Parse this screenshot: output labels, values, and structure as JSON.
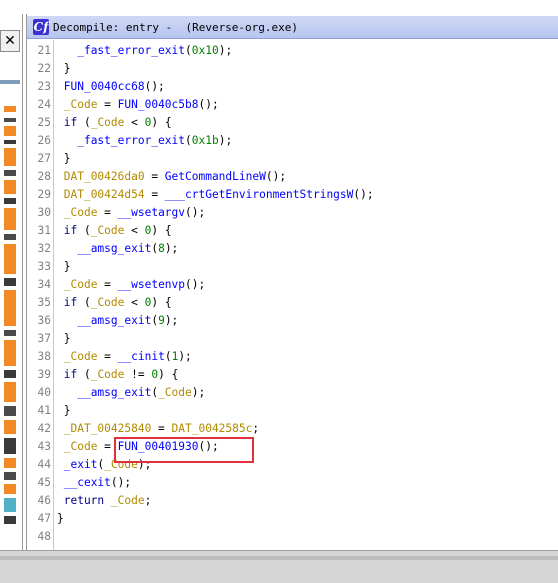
{
  "window": {
    "title": "Decompile: entry -  (Reverse-org.exe)",
    "icon_text": "Cf",
    "close_label": "✕"
  },
  "lines": [
    {
      "n": "21",
      "parts": [
        {
          "t": "   "
        },
        {
          "t": "_fast_error_exit",
          "c": "f"
        },
        {
          "t": "("
        },
        {
          "t": "0x10",
          "c": "n"
        },
        {
          "t": ");"
        }
      ]
    },
    {
      "n": "22",
      "parts": [
        {
          "t": " }"
        }
      ]
    },
    {
      "n": "23",
      "parts": [
        {
          "t": " "
        },
        {
          "t": "FUN_0040cc68",
          "c": "f"
        },
        {
          "t": "();"
        }
      ]
    },
    {
      "n": "24",
      "parts": [
        {
          "t": " "
        },
        {
          "t": "_Code",
          "c": "v"
        },
        {
          "t": " = "
        },
        {
          "t": "FUN_0040c5b8",
          "c": "f"
        },
        {
          "t": "();"
        }
      ]
    },
    {
      "n": "25",
      "parts": [
        {
          "t": " if",
          "c": "k"
        },
        {
          "t": " ("
        },
        {
          "t": "_Code",
          "c": "v"
        },
        {
          "t": " < "
        },
        {
          "t": "0",
          "c": "n"
        },
        {
          "t": ") {"
        }
      ]
    },
    {
      "n": "26",
      "parts": [
        {
          "t": "   "
        },
        {
          "t": "_fast_error_exit",
          "c": "f"
        },
        {
          "t": "("
        },
        {
          "t": "0x1b",
          "c": "n"
        },
        {
          "t": ");"
        }
      ]
    },
    {
      "n": "27",
      "parts": [
        {
          "t": " }"
        }
      ]
    },
    {
      "n": "28",
      "parts": [
        {
          "t": " "
        },
        {
          "t": "DAT_00426da0",
          "c": "v"
        },
        {
          "t": " = "
        },
        {
          "t": "GetCommandLineW",
          "c": "f"
        },
        {
          "t": "();"
        }
      ]
    },
    {
      "n": "29",
      "parts": [
        {
          "t": " "
        },
        {
          "t": "DAT_00424d54",
          "c": "v"
        },
        {
          "t": " = "
        },
        {
          "t": "___crtGetEnvironmentStringsW",
          "c": "f"
        },
        {
          "t": "();"
        }
      ]
    },
    {
      "n": "30",
      "parts": [
        {
          "t": " "
        },
        {
          "t": "_Code",
          "c": "v"
        },
        {
          "t": " = "
        },
        {
          "t": "__wsetargv",
          "c": "f"
        },
        {
          "t": "();"
        }
      ]
    },
    {
      "n": "31",
      "parts": [
        {
          "t": " if",
          "c": "k"
        },
        {
          "t": " ("
        },
        {
          "t": "_Code",
          "c": "v"
        },
        {
          "t": " < "
        },
        {
          "t": "0",
          "c": "n"
        },
        {
          "t": ") {"
        }
      ]
    },
    {
      "n": "32",
      "parts": [
        {
          "t": "   "
        },
        {
          "t": "__amsg_exit",
          "c": "f"
        },
        {
          "t": "("
        },
        {
          "t": "8",
          "c": "n"
        },
        {
          "t": ");"
        }
      ]
    },
    {
      "n": "33",
      "parts": [
        {
          "t": " }"
        }
      ]
    },
    {
      "n": "34",
      "parts": [
        {
          "t": " "
        },
        {
          "t": "_Code",
          "c": "v"
        },
        {
          "t": " = "
        },
        {
          "t": "__wsetenvp",
          "c": "f"
        },
        {
          "t": "();"
        }
      ]
    },
    {
      "n": "35",
      "parts": [
        {
          "t": " if",
          "c": "k"
        },
        {
          "t": " ("
        },
        {
          "t": "_Code",
          "c": "v"
        },
        {
          "t": " < "
        },
        {
          "t": "0",
          "c": "n"
        },
        {
          "t": ") {"
        }
      ]
    },
    {
      "n": "36",
      "parts": [
        {
          "t": "   "
        },
        {
          "t": "__amsg_exit",
          "c": "f"
        },
        {
          "t": "("
        },
        {
          "t": "9",
          "c": "n"
        },
        {
          "t": ");"
        }
      ]
    },
    {
      "n": "37",
      "parts": [
        {
          "t": " }"
        }
      ]
    },
    {
      "n": "38",
      "parts": [
        {
          "t": " "
        },
        {
          "t": "_Code",
          "c": "v"
        },
        {
          "t": " = "
        },
        {
          "t": "__cinit",
          "c": "f"
        },
        {
          "t": "("
        },
        {
          "t": "1",
          "c": "n"
        },
        {
          "t": ");"
        }
      ]
    },
    {
      "n": "39",
      "parts": [
        {
          "t": " if",
          "c": "k"
        },
        {
          "t": " ("
        },
        {
          "t": "_Code",
          "c": "v"
        },
        {
          "t": " != "
        },
        {
          "t": "0",
          "c": "n"
        },
        {
          "t": ") {"
        }
      ]
    },
    {
      "n": "40",
      "parts": [
        {
          "t": "   "
        },
        {
          "t": "__amsg_exit",
          "c": "f"
        },
        {
          "t": "("
        },
        {
          "t": "_Code",
          "c": "v"
        },
        {
          "t": ");"
        }
      ]
    },
    {
      "n": "41",
      "parts": [
        {
          "t": " }"
        }
      ]
    },
    {
      "n": "42",
      "parts": [
        {
          "t": " "
        },
        {
          "t": "_DAT_00425840",
          "c": "v"
        },
        {
          "t": " = "
        },
        {
          "t": "DAT_0042585c",
          "c": "v"
        },
        {
          "t": ";"
        }
      ]
    },
    {
      "n": "43",
      "parts": [
        {
          "t": " "
        },
        {
          "t": "_Code",
          "c": "v"
        },
        {
          "t": " = "
        },
        {
          "t": "FUN_00401930",
          "c": "f"
        },
        {
          "t": "();"
        }
      ]
    },
    {
      "n": "44",
      "parts": [
        {
          "t": " "
        },
        {
          "t": "_exit",
          "c": "f"
        },
        {
          "t": "("
        },
        {
          "t": "_Code",
          "c": "v"
        },
        {
          "t": ");"
        }
      ]
    },
    {
      "n": "45",
      "parts": [
        {
          "t": " "
        },
        {
          "t": "__cexit",
          "c": "f"
        },
        {
          "t": "();"
        }
      ]
    },
    {
      "n": "46",
      "parts": [
        {
          "t": " return",
          "c": "k"
        },
        {
          "t": " "
        },
        {
          "t": "_Code",
          "c": "v"
        },
        {
          "t": ";"
        }
      ]
    },
    {
      "n": "47",
      "parts": [
        {
          "t": "}"
        }
      ]
    },
    {
      "n": "48",
      "parts": []
    }
  ],
  "colors": {
    "function": "#0000ff",
    "variable": "#b08a00",
    "keyword": "#000080",
    "number": "#008000",
    "highlight_box": "#e0303b"
  }
}
